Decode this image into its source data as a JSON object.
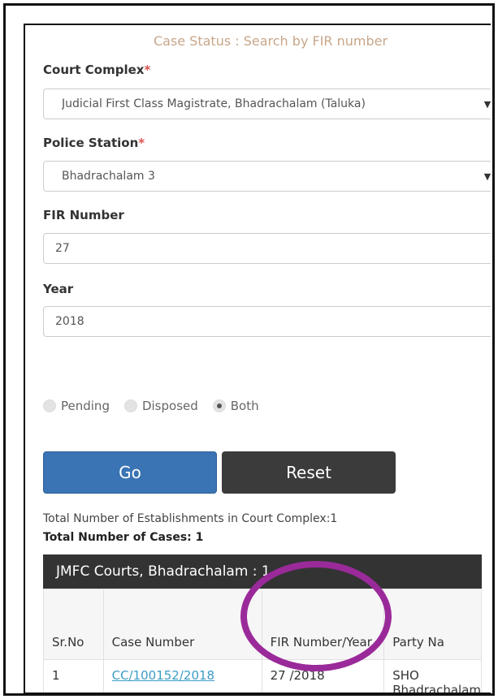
{
  "title": "Case Status : Search by FIR number",
  "court_complex": {
    "label": "Court Complex",
    "required_mark": "*",
    "value": "Judicial First Class Magistrate, Bhadrachalam (Taluka)"
  },
  "police_station": {
    "label": "Police Station",
    "required_mark": "*",
    "value": "Bhadrachalam 3"
  },
  "fir_number": {
    "label": "FIR Number",
    "value": "27"
  },
  "year": {
    "label": "Year",
    "value": "2018"
  },
  "status_filter": {
    "options": [
      {
        "label": "Pending",
        "selected": false
      },
      {
        "label": "Disposed",
        "selected": false
      },
      {
        "label": "Both",
        "selected": true
      }
    ]
  },
  "buttons": {
    "go": "Go",
    "reset": "Reset"
  },
  "summary": {
    "establishments": "Total Number of Establishments in Court Complex:1",
    "cases": "Total Number of Cases: 1"
  },
  "results": {
    "court_heading": "JMFC Courts, Bhadrachalam : 1",
    "columns": [
      "Sr.No",
      "Case Number",
      "FIR Number/Year",
      "Party Na"
    ],
    "rows": [
      {
        "sr_no": "1",
        "case_number": "CC/100152/2018",
        "fir_year": "27 /2018",
        "party_name": "SHO Bhadrachalam Town"
      }
    ]
  },
  "colors": {
    "highlight": "#9a2a9a",
    "go_button": "#3a74b4",
    "reset_button": "#3b3b3b",
    "link": "#3c9cc6"
  }
}
